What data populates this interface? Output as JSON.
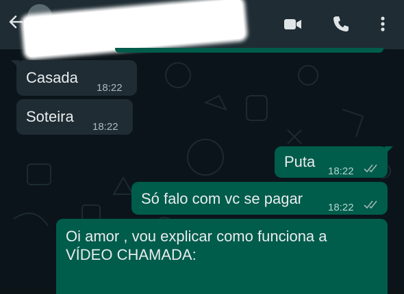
{
  "header": {
    "contact_name": "",
    "icons": [
      "back-arrow-icon",
      "video-call-icon",
      "phone-icon",
      "more-options-icon"
    ]
  },
  "colors": {
    "header_bg": "#1f2c33",
    "chat_bg": "#0b141a",
    "incoming_bubble": "#1f2c33",
    "outgoing_bubble": "#005c4b",
    "text": "#e9edef",
    "read_ticks": "#9fb7b1"
  },
  "messages": [
    {
      "direction": "incoming",
      "text": "Casada",
      "time": "18:22"
    },
    {
      "direction": "incoming",
      "text": "Soteira",
      "time": "18:22"
    },
    {
      "direction": "outgoing",
      "text": "Puta",
      "time": "18:22",
      "status": "read"
    },
    {
      "direction": "outgoing",
      "text": "Só falo com vc se pagar",
      "time": "18:22",
      "status": "read"
    },
    {
      "direction": "outgoing",
      "text": "Oi amor , vou explicar como funciona a VÍDEO CHAMADA:",
      "time": ""
    }
  ]
}
